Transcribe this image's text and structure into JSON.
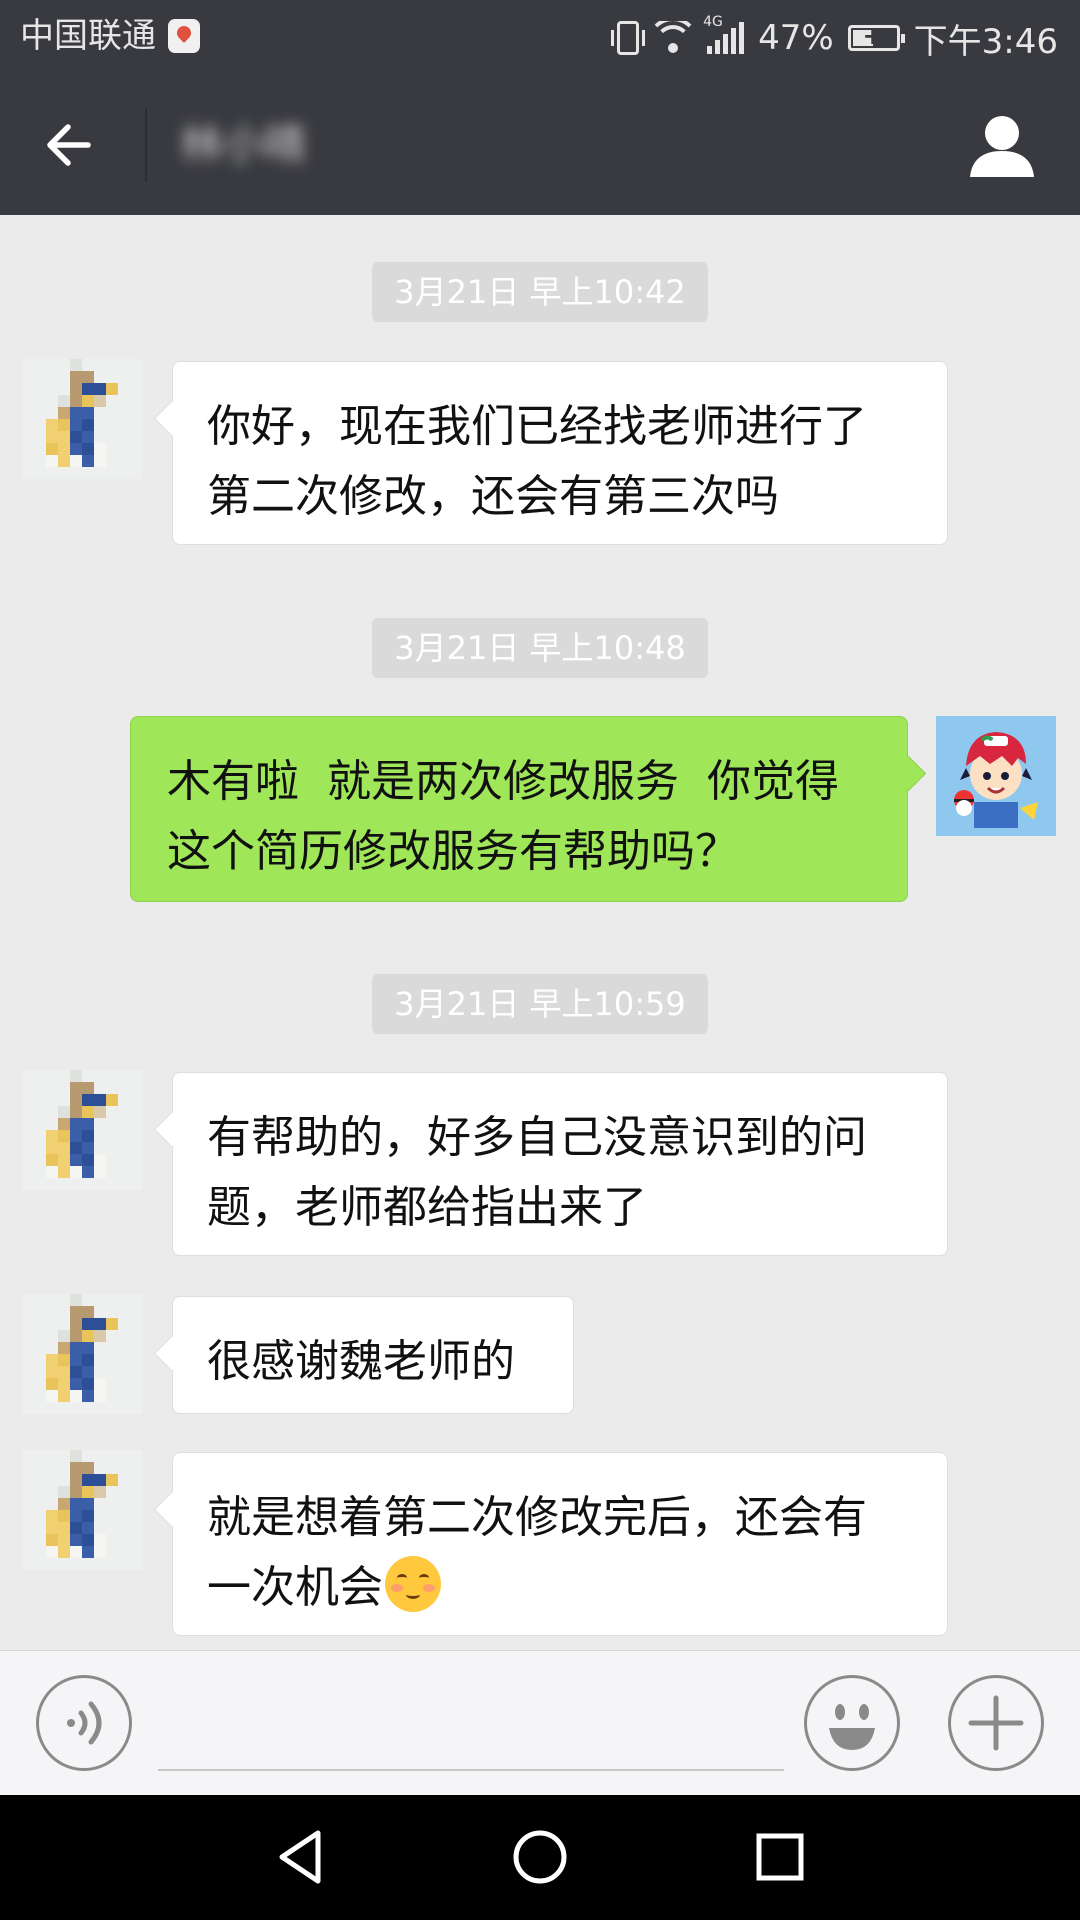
{
  "status_bar": {
    "carrier": "中国联通",
    "network": "4G",
    "battery_percent": "47%",
    "battery_level": 0.47,
    "time": "下午3:46"
  },
  "title_bar": {
    "back_icon": "arrow-left-icon",
    "contact_name": "林小晴",
    "profile_icon": "person-icon"
  },
  "messages": [
    {
      "type": "timestamp",
      "text": "3月21日 早上10:42"
    },
    {
      "type": "incoming",
      "lines": [
        "你好，现在我们已经找老师进行了",
        "第二次修改，还会有第三次吗"
      ]
    },
    {
      "type": "timestamp",
      "text": "3月21日 早上10:48"
    },
    {
      "type": "outgoing",
      "lines": [
        "木有啦  就是两次修改服务  你觉得",
        "这个简历修改服务有帮助吗？"
      ]
    },
    {
      "type": "timestamp",
      "text": "3月21日 早上10:59"
    },
    {
      "type": "incoming",
      "lines": [
        "有帮助的，好多自己没意识到的问",
        "题，老师都给指出来了"
      ]
    },
    {
      "type": "incoming",
      "lines": [
        "很感谢魏老师的"
      ]
    },
    {
      "type": "incoming",
      "lines": [
        "就是想着第二次修改完后，还会有",
        "一次机会"
      ],
      "emoji": "blushing-smile-emoji"
    }
  ],
  "input_bar": {
    "voice_icon": "voice-icon",
    "message_text": "",
    "emoji_icon": "smiley-face-icon",
    "plus_icon": "plus-icon"
  },
  "nav_bar": {
    "back_icon": "triangle-back-icon",
    "home_icon": "circle-home-icon",
    "recents_icon": "square-recents-icon"
  },
  "colors": {
    "header": "#393a3f",
    "chat_background": "#ebebeb",
    "incoming_bubble": "#ffffff",
    "outgoing_bubble": "#9fe659",
    "timestamp_chip": "#dadada"
  }
}
